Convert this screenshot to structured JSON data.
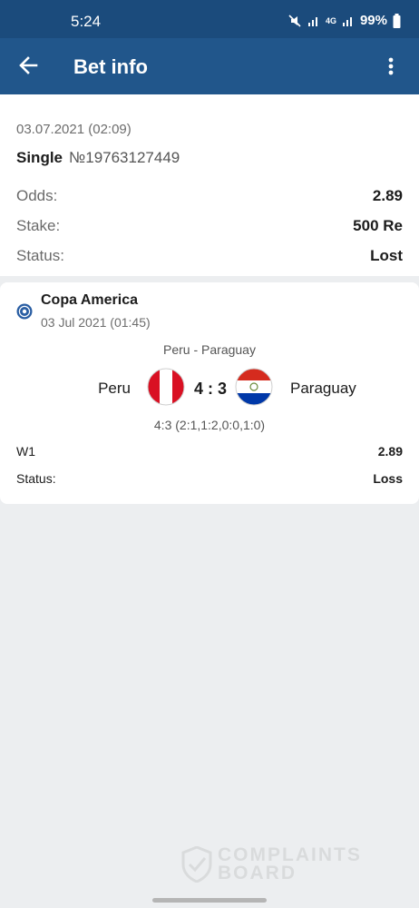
{
  "status_bar": {
    "time": "5:24",
    "network": "4G",
    "battery": "99%"
  },
  "header": {
    "title": "Bet info"
  },
  "bet": {
    "datetime": "03.07.2021 (02:09)",
    "type": "Single",
    "number": "№19763127449",
    "rows": [
      {
        "label": "Odds:",
        "value": "2.89"
      },
      {
        "label": "Stake:",
        "value": "500 Re"
      },
      {
        "label": "Status:",
        "value": "Lost"
      }
    ]
  },
  "event": {
    "league": "Copa America",
    "date": "03 Jul 2021 (01:45)",
    "match": "Peru - Paraguay",
    "home_team": "Peru",
    "away_team": "Paraguay",
    "score": "4 : 3",
    "score_detail": "4:3 (2:1,1:2,0:0,1:0)",
    "rows": [
      {
        "label": "W1",
        "value": "2.89"
      },
      {
        "label": "Status:",
        "value": "Loss"
      }
    ]
  },
  "watermark": {
    "title": "COMPLAINTS",
    "subtitle": "BOARD"
  },
  "colors": {
    "appbar": "#21568b",
    "statusbar": "#1b4b7c",
    "background": "#eceef0"
  },
  "icons": [
    "back-arrow-icon",
    "more-vert-icon",
    "league-icon",
    "peru-flag-icon",
    "paraguay-flag-icon"
  ]
}
